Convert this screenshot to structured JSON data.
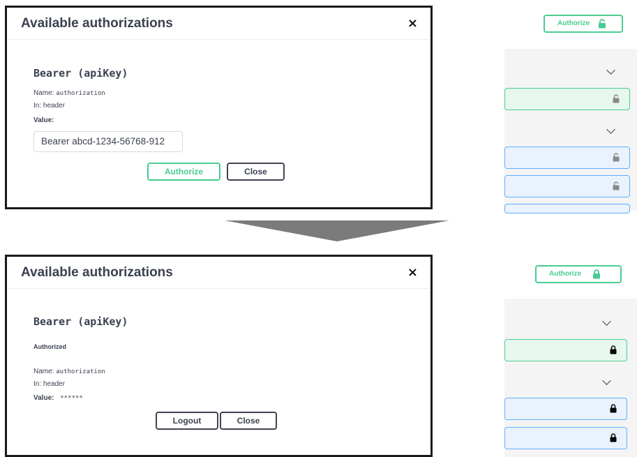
{
  "top_modal": {
    "title": "Available authorizations",
    "close_glyph": "×",
    "scheme_name": "Bearer (apiKey)",
    "name_label": "Name:",
    "name_value": "authorization",
    "in_label": "In:",
    "in_value": "header",
    "value_label": "Value:",
    "value_input": "Bearer abcd-1234-56768-912",
    "authorize_label": "Authorize",
    "close_label": "Close"
  },
  "bottom_modal": {
    "title": "Available authorizations",
    "close_glyph": "×",
    "scheme_name": "Bearer (apiKey)",
    "status": "Authorized",
    "name_label": "Name:",
    "name_value": "authorization",
    "in_label": "In:",
    "in_value": "header",
    "value_label": "Value:",
    "value_masked": "******",
    "logout_label": "Logout",
    "close_label": "Close"
  },
  "top_panel": {
    "authorize_label": "Authorize",
    "lock_state": "unlocked",
    "colors": {
      "green": "#49cc90",
      "blue": "#61affe",
      "lock_gray": "#8a8a8a"
    }
  },
  "bottom_panel": {
    "authorize_label": "Authorize",
    "lock_state": "locked",
    "colors": {
      "green": "#49cc90",
      "blue": "#61affe",
      "lock_black": "#000000"
    }
  }
}
